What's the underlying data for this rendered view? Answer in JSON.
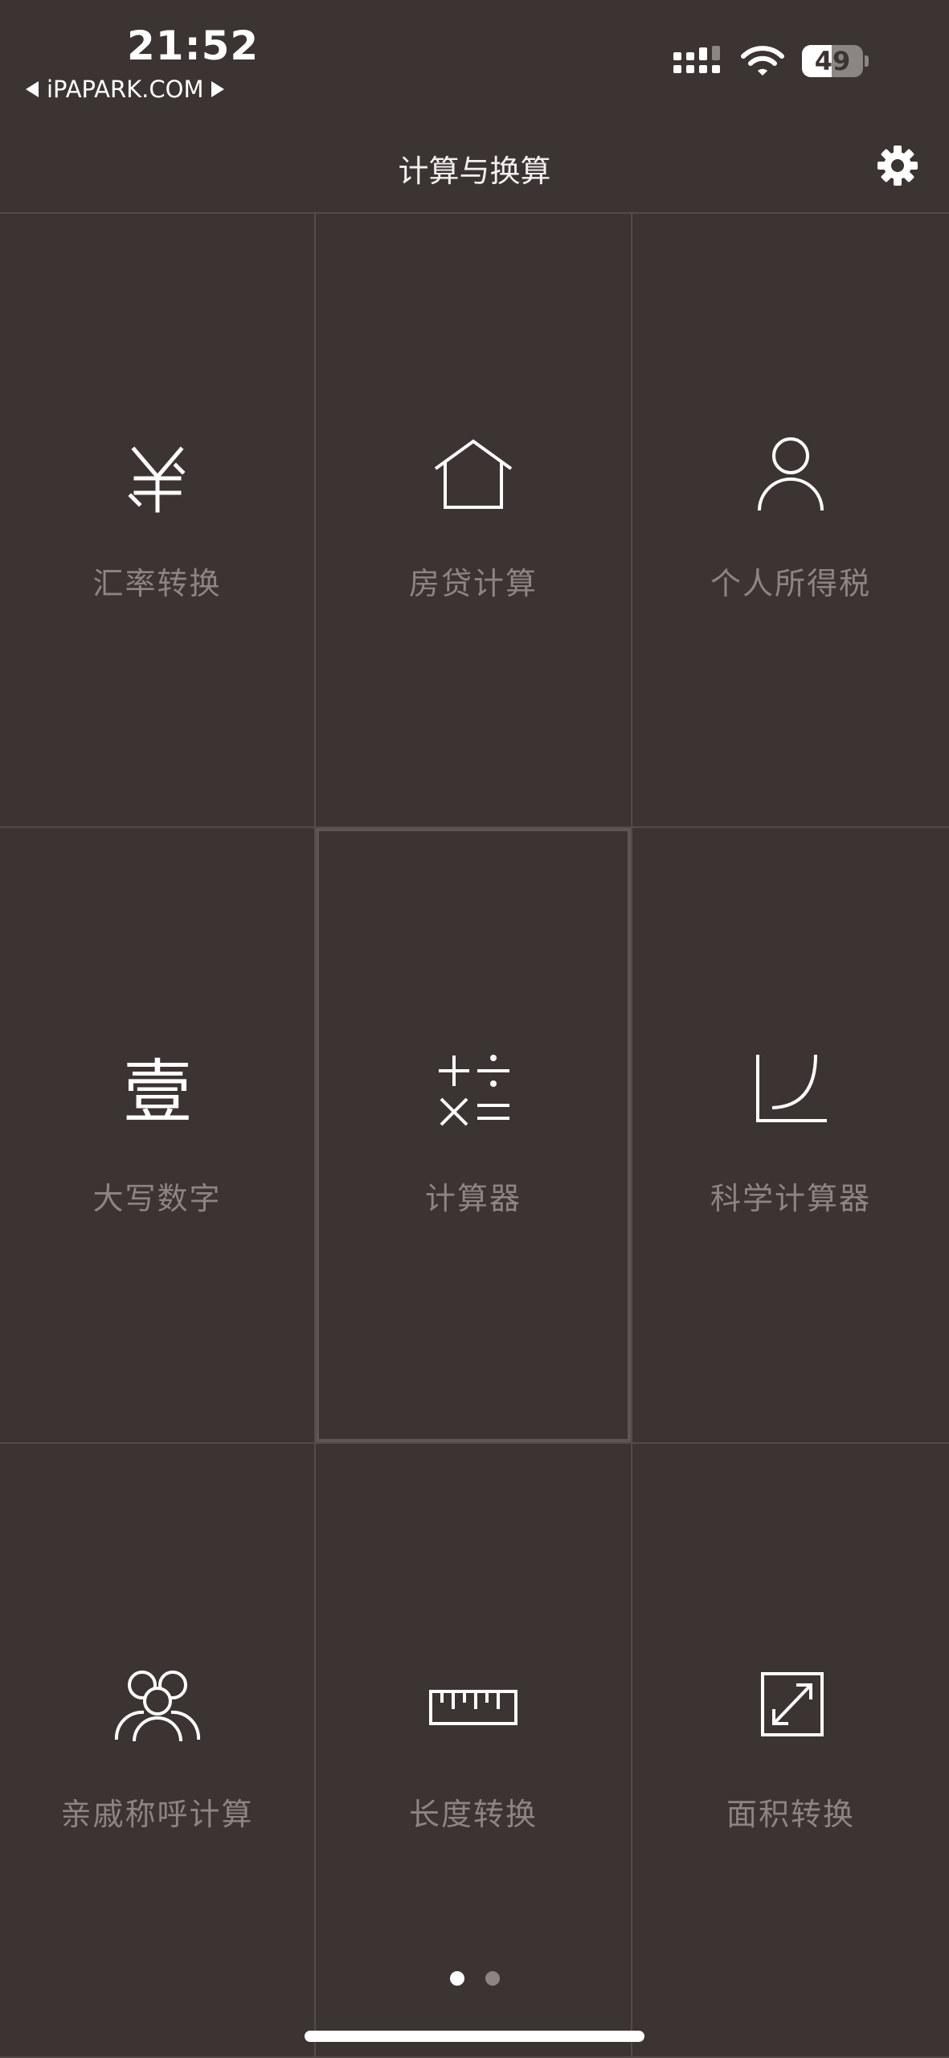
{
  "status_bar": {
    "time": "21:52",
    "back_label": "iPAPARK.COM",
    "battery_level": "49",
    "battery_percent": 49
  },
  "header": {
    "title": "计算与换算",
    "settings_icon": "gear-icon"
  },
  "tools": [
    {
      "label": "汇率转换",
      "icon": "yen-icon"
    },
    {
      "label": "房贷计算",
      "icon": "house-icon"
    },
    {
      "label": "个人所得税",
      "icon": "person-icon"
    },
    {
      "label": "大写数字",
      "icon": "chinese-numeral-icon"
    },
    {
      "label": "计算器",
      "icon": "calculator-icon",
      "selected": true
    },
    {
      "label": "科学计算器",
      "icon": "curve-graph-icon"
    },
    {
      "label": "亲戚称呼计算",
      "icon": "family-icon"
    },
    {
      "label": "长度转换",
      "icon": "ruler-icon"
    },
    {
      "label": "面积转换",
      "icon": "resize-icon"
    }
  ],
  "icon_glyphs": {
    "chinese_numeral": "壹"
  },
  "pagination": {
    "pages": 2,
    "current": 1
  },
  "colors": {
    "background": "#3c3432",
    "grid_line": "#544b49",
    "label": "#8d8583",
    "icon": "#ffffff"
  }
}
